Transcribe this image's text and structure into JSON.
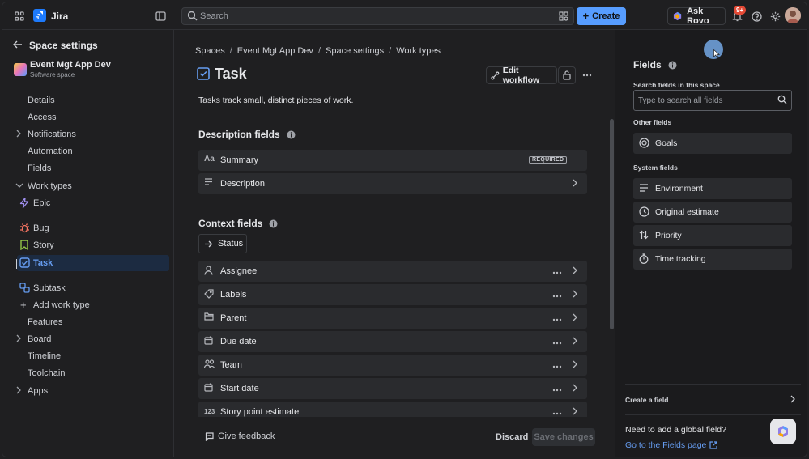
{
  "topbar": {
    "brand": "Jira",
    "search_placeholder": "Search",
    "create_label": "Create",
    "rovo_label": "Ask Rovo",
    "notifications_badge": "9+"
  },
  "sidebar": {
    "title": "Space settings",
    "project_name": "Event Mgt App Dev",
    "project_type": "Software space",
    "items": [
      {
        "label": "Details"
      },
      {
        "label": "Access"
      },
      {
        "label": "Notifications"
      },
      {
        "label": "Automation"
      },
      {
        "label": "Fields"
      },
      {
        "label": "Work types"
      },
      {
        "label": "Epic"
      },
      {
        "label": "Bug"
      },
      {
        "label": "Story"
      },
      {
        "label": "Task"
      },
      {
        "label": "Subtask"
      },
      {
        "label": "Add work type"
      },
      {
        "label": "Features"
      },
      {
        "label": "Board"
      },
      {
        "label": "Timeline"
      },
      {
        "label": "Toolchain"
      },
      {
        "label": "Apps"
      }
    ]
  },
  "main": {
    "breadcrumb": [
      "Spaces",
      "Event Mgt App Dev",
      "Space settings",
      "Work types"
    ],
    "title": "Task",
    "edit_workflow": "Edit workflow",
    "description": "Tasks track small, distinct pieces of work.",
    "description_fields_heading": "Description fields",
    "description_fields": [
      {
        "icon": "Aa",
        "label": "Summary",
        "badge": "REQUIRED"
      },
      {
        "icon": "lines-icon",
        "label": "Description"
      }
    ],
    "context_fields_heading": "Context fields",
    "status_label": "Status",
    "context_fields": [
      {
        "icon": "person-icon",
        "label": "Assignee"
      },
      {
        "icon": "tag-icon",
        "label": "Labels"
      },
      {
        "icon": "folder-icon",
        "label": "Parent"
      },
      {
        "icon": "calendar-icon",
        "label": "Due date"
      },
      {
        "icon": "people-icon",
        "label": "Team"
      },
      {
        "icon": "calendar-icon",
        "label": "Start date"
      },
      {
        "icon": "123",
        "label": "Story point estimate"
      }
    ],
    "footer": {
      "feedback": "Give feedback",
      "discard": "Discard",
      "save": "Save changes"
    }
  },
  "panel": {
    "title": "Fields",
    "search_label": "Search fields in this space",
    "search_placeholder": "Type to search all fields",
    "other_fields_label": "Other fields",
    "other_fields": [
      {
        "label": "Goals"
      }
    ],
    "system_fields_label": "System fields",
    "system_fields": [
      {
        "label": "Environment"
      },
      {
        "label": "Original estimate"
      },
      {
        "label": "Priority"
      },
      {
        "label": "Time tracking"
      }
    ],
    "create_field": "Create a field",
    "need_global": "Need to add a global field?",
    "goto_fields": "Go to the Fields page"
  },
  "colors": {
    "accent": "#579dff",
    "active_nav": "#669df1",
    "background": "#1f1f21",
    "panel_bg": "#1b1b1d",
    "row_bg": "#2a2b2e"
  }
}
